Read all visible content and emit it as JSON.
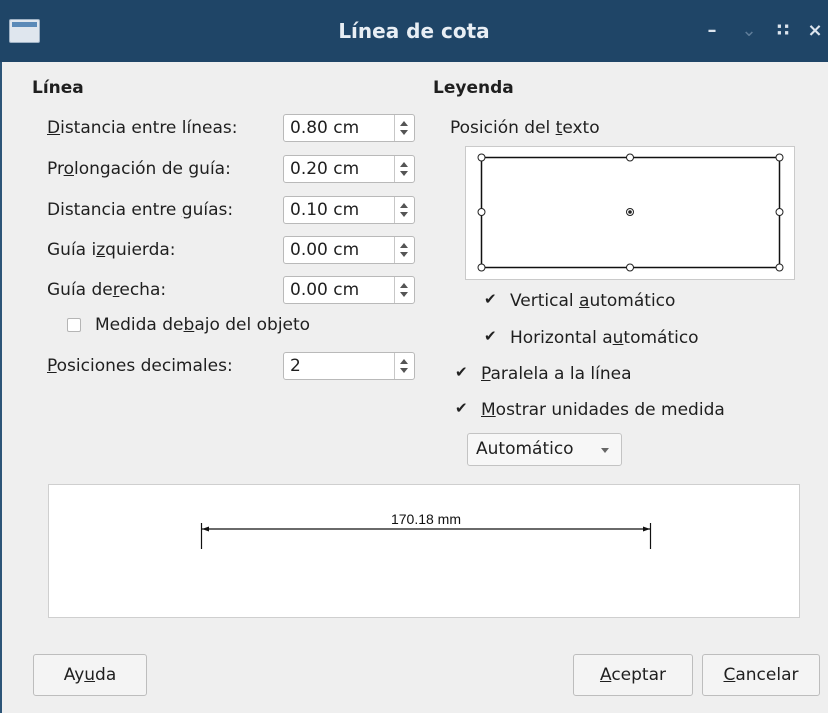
{
  "window": {
    "title": "Línea de cota",
    "minimize": "–",
    "maximize": "⌄",
    "menu": "∷",
    "close": "×"
  },
  "linea": {
    "title": "Línea",
    "fields": [
      {
        "pre": "",
        "key": "D",
        "post": "istancia entre líneas:",
        "value": "0.80 cm"
      },
      {
        "pre": "Pr",
        "key": "o",
        "post": "longación de guía:",
        "value": "0.20 cm"
      },
      {
        "pre": "Distancia entre ",
        "key": "g",
        "post": "uías:",
        "value": "0.10 cm"
      },
      {
        "pre": "Guía i",
        "key": "z",
        "post": "quierda:",
        "value": "0.00 cm"
      },
      {
        "pre": "Guía de",
        "key": "r",
        "post": "echa:",
        "value": "0.00 cm"
      }
    ],
    "below_object": {
      "pre": "Medida de",
      "key": "b",
      "post": "ajo del objeto",
      "checked": false
    },
    "decimals": {
      "pre": "",
      "key": "P",
      "post": "osiciones decimales:",
      "value": "2"
    }
  },
  "leyenda": {
    "title": "Leyenda",
    "text_position": {
      "pre": "Posición del ",
      "key": "t",
      "post": "exto"
    },
    "vertical_auto": {
      "pre": "Vertical ",
      "key": "a",
      "post": "utomático",
      "checked": true
    },
    "horizontal_auto": {
      "pre": "Horizontal a",
      "key": "u",
      "post": "tomático",
      "checked": true
    },
    "parallel": {
      "pre": "",
      "key": "P",
      "post": "aralela a la línea",
      "checked": true
    },
    "show_units": {
      "pre": "",
      "key": "M",
      "post": "ostrar unidades de medida",
      "checked": true
    },
    "unit_select": "Automático"
  },
  "preview": {
    "measure": "170.18 mm"
  },
  "buttons": {
    "help": {
      "pre": "Ay",
      "key": "u",
      "post": "da"
    },
    "ok": {
      "pre": "",
      "key": "A",
      "post": "ceptar"
    },
    "cancel": {
      "pre": "",
      "key": "C",
      "post": "ancelar"
    }
  }
}
